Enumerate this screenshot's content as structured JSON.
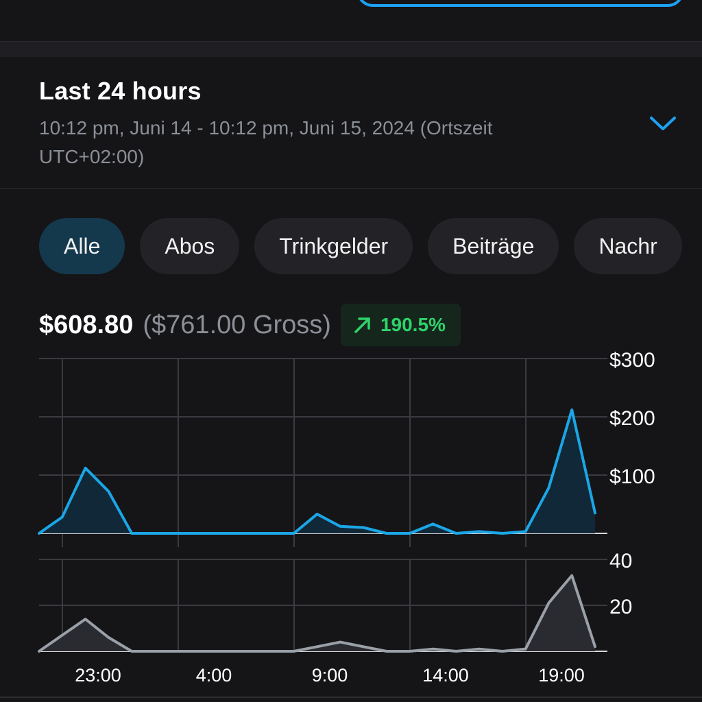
{
  "period": {
    "title": "Last 24 hours",
    "range": "10:12 pm, Juni 14 - 10:12 pm, Juni 15, 2024 (Ortszeit UTC+02:00)"
  },
  "filters": {
    "items": [
      {
        "label": "Alle",
        "active": true
      },
      {
        "label": "Abos",
        "active": false
      },
      {
        "label": "Trinkgelder",
        "active": false
      },
      {
        "label": "Beiträge",
        "active": false
      },
      {
        "label": "Nachr",
        "active": false
      }
    ]
  },
  "summary": {
    "net": "$608.80",
    "gross": "($761.00 Gross)",
    "change": "190.5%"
  },
  "colors": {
    "accent": "#1da1f2",
    "earnings_line": "#1ba6e6",
    "count_line": "#9aa0a8",
    "positive": "#2fd36a"
  },
  "icons": {
    "chevron": "chevron-down-icon",
    "trend": "arrow-up-right-icon"
  },
  "chart_data": [
    {
      "type": "area",
      "x": [
        "22:00",
        "23:00",
        "0:00",
        "1:00",
        "2:00",
        "3:00",
        "4:00",
        "5:00",
        "6:00",
        "7:00",
        "8:00",
        "9:00",
        "10:00",
        "11:00",
        "12:00",
        "13:00",
        "14:00",
        "15:00",
        "16:00",
        "17:00",
        "18:00",
        "19:00",
        "20:00",
        "21:00",
        "22:00"
      ],
      "values": [
        0,
        28,
        112,
        72,
        0,
        0,
        0,
        0,
        0,
        0,
        0,
        0,
        33,
        12,
        10,
        0,
        0,
        16,
        0,
        3,
        0,
        3,
        78,
        212,
        35
      ],
      "ylim": [
        0,
        300
      ],
      "yticks": [
        "$100",
        "$200",
        "$300"
      ],
      "xticks": [
        "23:00",
        "4:00",
        "9:00",
        "14:00",
        "19:00"
      ]
    },
    {
      "type": "area",
      "x": [
        "22:00",
        "23:00",
        "0:00",
        "1:00",
        "2:00",
        "3:00",
        "4:00",
        "5:00",
        "6:00",
        "7:00",
        "8:00",
        "9:00",
        "10:00",
        "11:00",
        "12:00",
        "13:00",
        "14:00",
        "15:00",
        "16:00",
        "17:00",
        "18:00",
        "19:00",
        "20:00",
        "21:00",
        "22:00"
      ],
      "values": [
        0,
        7,
        14,
        6,
        0,
        0,
        0,
        0,
        0,
        0,
        0,
        0,
        2,
        4,
        2,
        0,
        0,
        1,
        0,
        1,
        0,
        1,
        21,
        33,
        2
      ],
      "ylim": [
        0,
        40
      ],
      "yticks": [
        "20",
        "40"
      ]
    }
  ]
}
